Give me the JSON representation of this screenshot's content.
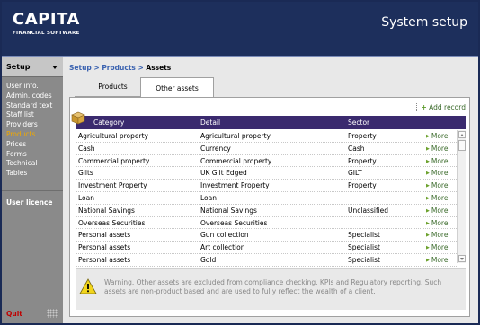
{
  "brand": {
    "name": "CAPITA",
    "subtitle": "FINANCIAL SOFTWARE"
  },
  "header": {
    "title": "System setup"
  },
  "sidebar": {
    "section": "Setup",
    "items": [
      {
        "label": "User info."
      },
      {
        "label": "Admin. codes"
      },
      {
        "label": "Standard text"
      },
      {
        "label": "Staff list"
      },
      {
        "label": "Providers"
      },
      {
        "label": "Products",
        "active": true
      },
      {
        "label": "Prices"
      },
      {
        "label": "Forms"
      },
      {
        "label": "Technical"
      },
      {
        "label": "Tables"
      }
    ],
    "licence": "User licence",
    "quit": "Quit"
  },
  "breadcrumb": {
    "part1": "Setup",
    "sep": " > ",
    "part2": "Products",
    "current": "Assets"
  },
  "tabs": [
    {
      "label": "Products"
    },
    {
      "label": "Other assets",
      "active": true
    }
  ],
  "panel": {
    "add_record": "Add record"
  },
  "table": {
    "columns": [
      "Category",
      "Detail",
      "Sector"
    ],
    "more_label": "More",
    "rows": [
      {
        "category": "Agricultural property",
        "detail": "Agricultural property",
        "sector": "Property"
      },
      {
        "category": "Cash",
        "detail": "Currency",
        "sector": "Cash"
      },
      {
        "category": "Commercial property",
        "detail": "Commercial property",
        "sector": "Property"
      },
      {
        "category": "Gilts",
        "detail": "UK Gilt Edged",
        "sector": "GILT"
      },
      {
        "category": "Investment Property",
        "detail": "Investment Property",
        "sector": "Property"
      },
      {
        "category": "Loan",
        "detail": "Loan",
        "sector": ""
      },
      {
        "category": "National Savings",
        "detail": "National Savings",
        "sector": "Unclassified"
      },
      {
        "category": "Overseas Securities",
        "detail": "Overseas Securities",
        "sector": ""
      },
      {
        "category": "Personal assets",
        "detail": "Gun collection",
        "sector": "Specialist"
      },
      {
        "category": "Personal assets",
        "detail": "Art collection",
        "sector": "Specialist"
      },
      {
        "category": "Personal assets",
        "detail": "Gold",
        "sector": "Specialist"
      }
    ]
  },
  "warning": "Warning. Other assets are excluded from compliance checking, KPIs and Regulatory reporting. Such assets are non-product based and are used to fully reflect the wealth of a client.",
  "colors": {
    "header": "#1d2f5c",
    "table_head": "#3a2a6e",
    "active_nav": "#f0a800",
    "link": "#3a62b0"
  }
}
